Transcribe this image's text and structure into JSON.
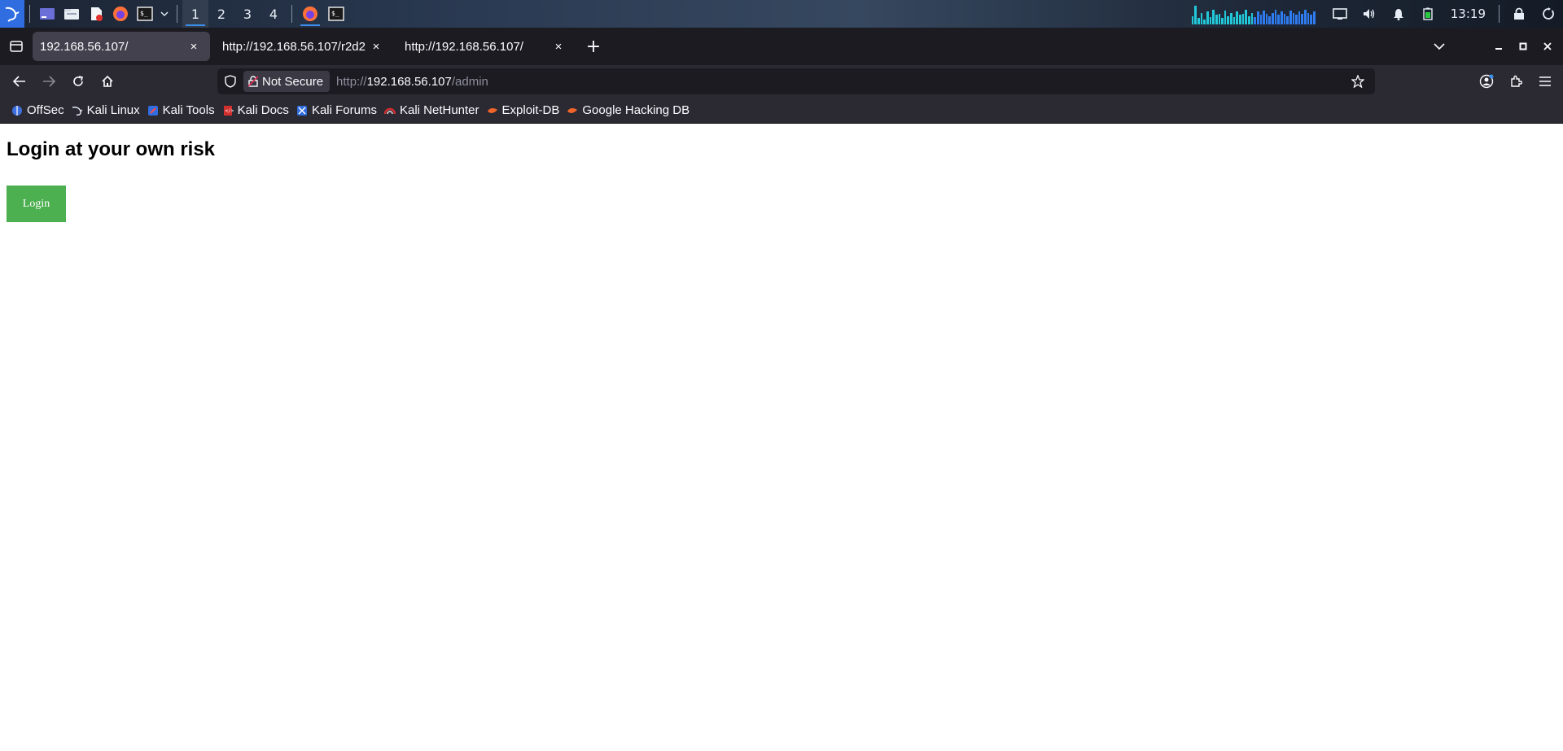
{
  "taskbar": {
    "workspaces": [
      "1",
      "2",
      "3",
      "4"
    ],
    "active_workspace": "1",
    "clock": "13:19",
    "icons": [
      "kali-menu-icon",
      "desktop-icon",
      "file-manager-icon",
      "text-editor-icon",
      "firefox-icon",
      "terminal-icon",
      "chevron-down-icon",
      "firefox-taskbar-icon",
      "terminal-taskbar-icon",
      "cpu-graph",
      "display-icon",
      "volume-icon",
      "bell-icon",
      "battery-icon",
      "lock-icon",
      "power-icon"
    ],
    "accent": "#3b8eea"
  },
  "tabs": [
    {
      "title": "192.168.56.107/",
      "selected": true
    },
    {
      "title": "http://192.168.56.107/r2d2",
      "selected": false
    },
    {
      "title": "http://192.168.56.107/",
      "selected": false
    }
  ],
  "tab_close_glyph": "×",
  "new_tab_glyph": "+",
  "urlbar": {
    "security_label": "Not Secure",
    "scheme": "http://",
    "host": "192.168.56.107",
    "path": "/admin"
  },
  "bookmarks": [
    {
      "label": "OffSec",
      "icon": "offsec-icon"
    },
    {
      "label": "Kali Linux",
      "icon": "kali-dragon-icon"
    },
    {
      "label": "Kali Tools",
      "icon": "kali-tools-icon"
    },
    {
      "label": "Kali Docs",
      "icon": "kali-docs-icon"
    },
    {
      "label": "Kali Forums",
      "icon": "kali-forums-icon"
    },
    {
      "label": "Kali NetHunter",
      "icon": "nethunter-icon"
    },
    {
      "label": "Exploit-DB",
      "icon": "exploit-db-icon"
    },
    {
      "label": "Google Hacking DB",
      "icon": "ghdb-icon"
    }
  ],
  "page": {
    "heading": "Login at your own risk",
    "login_button": "Login",
    "button_color": "#4caf50"
  }
}
